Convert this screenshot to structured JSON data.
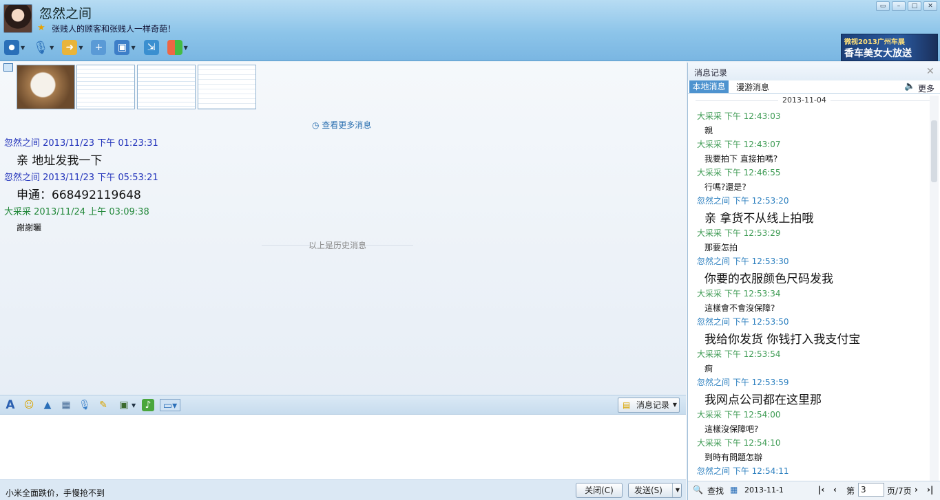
{
  "header": {
    "contact_name": "忽然之间",
    "signature": "张贱人的顾客和张贱人一样奇葩！",
    "ad_line1": "微视2013广州车展",
    "ad_line2": "香车美女大放送"
  },
  "chat": {
    "view_more": "查看更多消息",
    "messages": [
      {
        "header": "忽然之间 2013/11/23 下午 01:23:31",
        "text": "亲  地址发我一下"
      },
      {
        "header": "忽然之间 2013/11/23 下午 05:53:21",
        "text": "申通：668492119648"
      },
      {
        "header": "大采采 2013/11/24 上午 03:09:38",
        "text": "謝謝曬"
      }
    ],
    "history_separator": "以上是历史消息"
  },
  "format_bar": {
    "record_button": "消息记录"
  },
  "bottom": {
    "ad_text": "小米全面跌价，手慢抢不到",
    "close_button": "关闭(C)",
    "send_button": "发送(S)"
  },
  "panel": {
    "title": "消息记录",
    "tab_local": "本地消息",
    "tab_roam": "漫游消息",
    "more": "更多",
    "date": "2013-11-04",
    "records": [
      {
        "header": "大采采 下午 12:43:03",
        "text": "親"
      },
      {
        "header": "大采采 下午 12:43:07",
        "text": "我要拍下 直接拍嗎?"
      },
      {
        "header": "大采采 下午 12:46:55",
        "text": "行嗎?還是?"
      },
      {
        "header": "忽然之间 下午 12:53:20",
        "text": "亲  拿货不从线上拍哦"
      },
      {
        "header": "大采采 下午 12:53:29",
        "text": "那要怎拍"
      },
      {
        "header": "忽然之间 下午 12:53:30",
        "text": "你要的衣服颜色尺码发我"
      },
      {
        "header": "大采采 下午 12:53:34",
        "text": "這樣會不會沒保障?"
      },
      {
        "header": "忽然之间 下午 12:53:50",
        "text": "我给你发货  你钱打入我支付宝"
      },
      {
        "header": "大采采 下午 12:53:54",
        "text": "痾"
      },
      {
        "header": "忽然之间 下午 12:53:59",
        "text": "我网点公司都在这里那"
      },
      {
        "header": "大采采 下午 12:54:00",
        "text": "這樣沒保障吧?"
      },
      {
        "header": "大采采 下午 12:54:10",
        "text": "到時有問題怎辦"
      },
      {
        "header": "忽然之间 下午 12:54:11",
        "text": ""
      }
    ],
    "pager": {
      "search": "查找",
      "date": "2013-11-1",
      "page_prefix": "第",
      "page_value": "3",
      "page_suffix": "页/7页"
    }
  }
}
